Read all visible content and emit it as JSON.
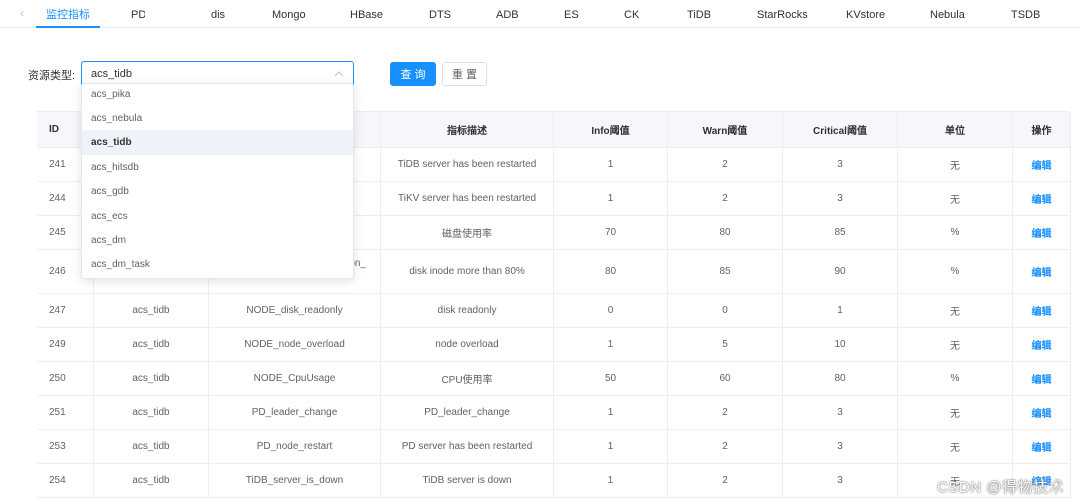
{
  "tabs": [
    {
      "label": "监控指标",
      "active": true
    },
    {
      "label": "PD"
    },
    {
      "label": "dis"
    },
    {
      "label": "Mongo"
    },
    {
      "label": "HBase"
    },
    {
      "label": "DTS"
    },
    {
      "label": "ADB"
    },
    {
      "label": "ES"
    },
    {
      "label": "CK"
    },
    {
      "label": "TiDB"
    },
    {
      "label": "StarRocks"
    },
    {
      "label": "KVstore"
    },
    {
      "label": "Nebula"
    },
    {
      "label": "TSDB"
    }
  ],
  "filter": {
    "label": "资源类型:",
    "value": "acs_tidb",
    "query_button": "查 询",
    "reset_button": "重 置"
  },
  "dropdown": {
    "options": [
      "acs_pika",
      "acs_nebula",
      "acs_tidb",
      "acs_hitsdb",
      "acs_gdb",
      "acs_ecs",
      "acs_dm",
      "acs_dm_task"
    ],
    "selected": "acs_tidb"
  },
  "table": {
    "headers": [
      "ID",
      "",
      "",
      "指标描述",
      "Info阈值",
      "Warn阈值",
      "Critical阈值",
      "单位",
      "操作"
    ],
    "rows": [
      {
        "id": "241",
        "type": "",
        "name": "",
        "desc": "TiDB server has been restarted",
        "info": "1",
        "warn": "2",
        "critical": "3",
        "unit": "无",
        "op": "编辑"
      },
      {
        "id": "244",
        "type": "",
        "name": "",
        "desc": "TiKV server has been restarted",
        "info": "1",
        "warn": "2",
        "critical": "3",
        "unit": "无",
        "op": "编辑"
      },
      {
        "id": "245",
        "type": "",
        "name": "",
        "desc": "磁盘使用率",
        "info": "70",
        "warn": "80",
        "critical": "85",
        "unit": "%",
        "op": "编辑"
      },
      {
        "id": "246",
        "type": "",
        "name": "on_",
        "desc": "disk inode more than 80%",
        "info": "80",
        "warn": "85",
        "critical": "90",
        "unit": "%",
        "op": "编辑"
      },
      {
        "id": "247",
        "type": "acs_tidb",
        "name": "NODE_disk_readonly",
        "desc": "disk readonly",
        "info": "0",
        "warn": "0",
        "critical": "1",
        "unit": "无",
        "op": "编辑"
      },
      {
        "id": "249",
        "type": "acs_tidb",
        "name": "NODE_node_overload",
        "desc": "node overload",
        "info": "1",
        "warn": "5",
        "critical": "10",
        "unit": "无",
        "op": "编辑"
      },
      {
        "id": "250",
        "type": "acs_tidb",
        "name": "NODE_CpuUsage",
        "desc": "CPU使用率",
        "info": "50",
        "warn": "60",
        "critical": "80",
        "unit": "%",
        "op": "编辑"
      },
      {
        "id": "251",
        "type": "acs_tidb",
        "name": "PD_leader_change",
        "desc": "PD_leader_change",
        "info": "1",
        "warn": "2",
        "critical": "3",
        "unit": "无",
        "op": "编辑"
      },
      {
        "id": "253",
        "type": "acs_tidb",
        "name": "PD_node_restart",
        "desc": "PD server has been restarted",
        "info": "1",
        "warn": "2",
        "critical": "3",
        "unit": "无",
        "op": "编辑"
      },
      {
        "id": "254",
        "type": "acs_tidb",
        "name": "TiDB_server_is_down",
        "desc": "TiDB server is down",
        "info": "1",
        "warn": "2",
        "critical": "3",
        "unit": "无",
        "op": "编辑"
      }
    ]
  },
  "watermark": "CSDN @得物技术",
  "colors": {
    "accent": "#1890ff",
    "header_bg": "#f5f7fa",
    "border": "#ebeef5",
    "selected_bg": "#eef2f9"
  }
}
